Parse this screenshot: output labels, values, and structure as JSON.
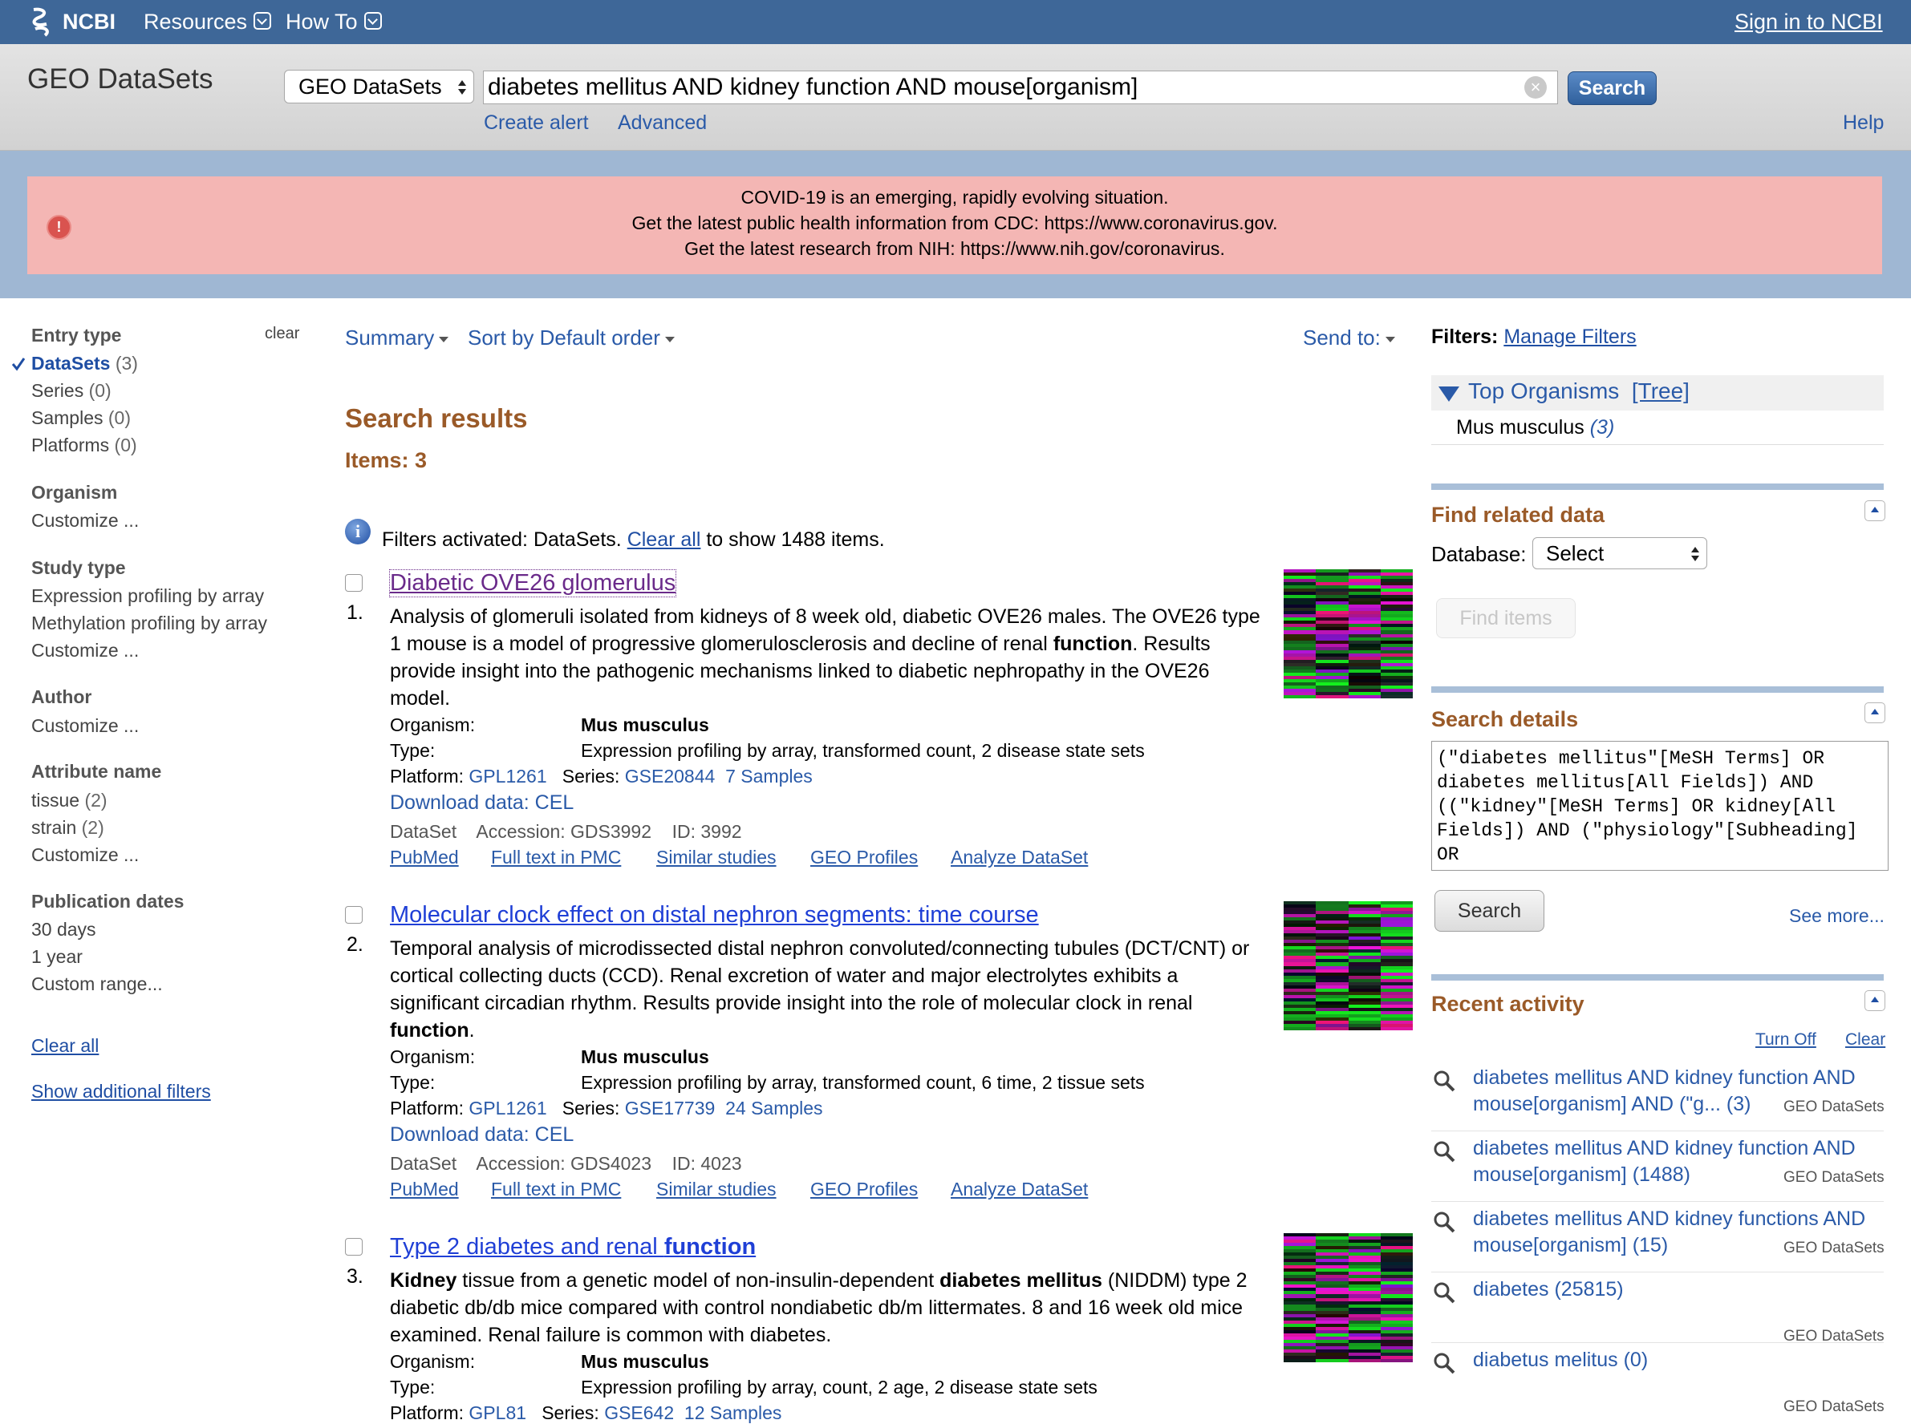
{
  "ncbi_bar": {
    "logo": "NCBI",
    "resources": "Resources",
    "howto": "How To",
    "signin": "Sign in to NCBI"
  },
  "header": {
    "db_title": "GEO DataSets",
    "db_select": "GEO DataSets",
    "query": "diabetes mellitus AND kidney function AND mouse[organism]",
    "search": "Search",
    "create_alert": "Create alert",
    "advanced": "Advanced",
    "help": "Help"
  },
  "banner": {
    "line1": "COVID-19 is an emerging, rapidly evolving situation.",
    "line2_pre": "Get the latest public health information from CDC:",
    "line2_link": "https://www.coronavirus.gov",
    "line2_post": ".",
    "line3_pre": "Get the latest research from NIH:",
    "line3_link": "https://www.nih.gov/coronavirus",
    "line3_post": "."
  },
  "sidebar": {
    "entry_type": "Entry type",
    "clear": "clear",
    "datasets": "DataSets",
    "datasets_cnt": "(3)",
    "series": "Series",
    "series_cnt": "(0)",
    "samples": "Samples",
    "samples_cnt": "(0)",
    "platforms": "Platforms",
    "platforms_cnt": "(0)",
    "organism": "Organism",
    "customize": "Customize ...",
    "study_type": "Study type",
    "study1": "Expression profiling by array",
    "study2": "Methylation profiling by array",
    "author": "Author",
    "attribute": "Attribute name",
    "attr1": "tissue",
    "attr1_cnt": "(2)",
    "attr2": "strain",
    "attr2_cnt": "(2)",
    "pub_dates": "Publication dates",
    "d30": "30 days",
    "y1": "1 year",
    "custom_range": "Custom range...",
    "clear_all": "Clear all",
    "show_filters": "Show additional filters"
  },
  "toolbar": {
    "summary": "Summary",
    "sort": "Sort by Default order",
    "send_to": "Send to:"
  },
  "results": {
    "heading": "Search results",
    "items": "Items: 3",
    "filters_pre": "Filters activated: DataSets.",
    "clear_all": "Clear all",
    "filters_post": "to show 1488 items.",
    "labels": {
      "organism": "Organism:",
      "type": "Type:",
      "platform": "Platform:",
      "series": "Series:",
      "dataset": "DataSet",
      "download": "Download data: CEL"
    },
    "list": [
      {
        "num": "1.",
        "title": "Diabetic OVE26 glomerulus",
        "desc_a": "Analysis of glomeruli isolated from kidneys of 8 week old, diabetic OVE26 males. The OVE26 type 1 mouse is a model of progressive glomerulosclerosis and decline of renal ",
        "desc_b": "function",
        "desc_c": ". Results provide insight into the pathogenic mechanisms linked to diabetic nephropathy in the OVE26 model.",
        "organism": "Mus musculus",
        "type": "Expression profiling by array, transformed count, 2 disease state sets",
        "platform": "GPL1261",
        "series": "GSE20844",
        "samples": "7 Samples",
        "accession": "Accession: GDS3992",
        "id": "ID: 3992",
        "links": [
          "PubMed",
          "Full text in PMC",
          "Similar studies",
          "GEO Profiles",
          "Analyze DataSet"
        ]
      },
      {
        "num": "2.",
        "title": "Molecular clock effect on distal nephron segments: time course",
        "desc_a": "Temporal analysis of microdissected distal nephron convoluted/connecting tubules (DCT/CNT) or cortical collecting ducts (CCD). Renal excretion of water and major electrolytes exhibits a significant circadian rhythm. Results provide insight into the role of molecular clock in renal ",
        "desc_b": "function",
        "desc_c": ".",
        "organism": "Mus musculus",
        "type": "Expression profiling by array, transformed count, 6 time, 2 tissue sets",
        "platform": "GPL1261",
        "series": "GSE17739",
        "samples": "24 Samples",
        "accession": "Accession: GDS4023",
        "id": "ID: 4023",
        "links": [
          "PubMed",
          "Full text in PMC",
          "Similar studies",
          "GEO Profiles",
          "Analyze DataSet"
        ]
      },
      {
        "num": "3.",
        "title_a": "Type 2 diabetes and renal ",
        "title_b": "function",
        "desc_k1": "Kidney",
        "desc_a": " tissue from a genetic model of non-insulin-dependent ",
        "desc_k2": "diabetes mellitus",
        "desc_c": " (NIDDM) type 2 diabetic db/db mice compared with control nondiabetic db/m littermates. 8 and 16 week old mice examined. Renal failure is common with diabetes.",
        "organism": "Mus musculus",
        "type": "Expression profiling by array, count, 2 age, 2 disease state sets",
        "platform": "GPL81",
        "series": "GSE642",
        "samples": "12 Samples"
      }
    ]
  },
  "right": {
    "filters": "Filters:",
    "manage": "Manage Filters",
    "top_org": "Top Organisms",
    "tree": "[Tree]",
    "org": "Mus musculus",
    "org_cnt": "(3)",
    "find_related": "Find related data",
    "database": "Database:",
    "db_select": "Select",
    "find_items": "Find items",
    "search_details": "Search details",
    "details_text": "(\"diabetes mellitus\"[MeSH Terms] OR diabetes mellitus[All Fields]) AND ((\"kidney\"[MeSH Terms] OR kidney[All Fields]) AND (\"physiology\"[Subheading] OR",
    "search": "Search",
    "see_more": "See more...",
    "recent": "Recent activity",
    "turn_off": "Turn Off",
    "clear": "Clear",
    "activity": [
      {
        "text": "diabetes mellitus AND kidney function AND mouse[organism] AND (\"g... (3)",
        "src": "GEO DataSets"
      },
      {
        "text": "diabetes mellitus AND kidney function AND mouse[organism] (1488)",
        "src": "GEO DataSets"
      },
      {
        "text": "diabetes mellitus AND kidney functions AND mouse[organism] (15)",
        "src": "GEO DataSets"
      },
      {
        "text": "diabetes (25815)",
        "src": "GEO DataSets"
      },
      {
        "text": "diabetus melitus (0)",
        "src": "GEO DataSets"
      }
    ]
  }
}
